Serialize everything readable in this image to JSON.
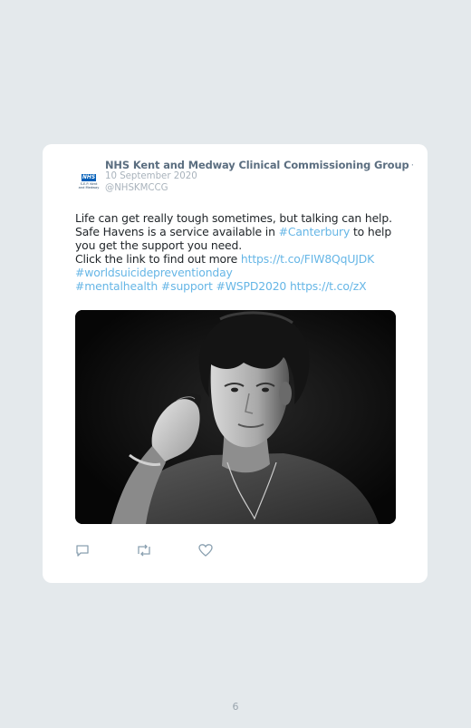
{
  "tweet": {
    "logo_mark": "NHS",
    "logo_lines": [
      "S.E.P. Kent",
      "and Medway"
    ],
    "author_name": "NHS Kent and Medway Clinical Commissioning Group",
    "name_separator": "·",
    "date": "10 September 2020",
    "handle": "@NHSKMCCG",
    "text": {
      "line1": "Life can get really tough sometimes, but talking can help.",
      "line2_before": "Safe Havens is a service available in ",
      "line2_link": "#Canterbury",
      "line2_after": " to help",
      "line3": "you get the support you need.",
      "line4_before": "Click the link to find out more ",
      "line4_link": "https://t.co/FIW8QqUJDK",
      "line5_link": "#worldsuicidepreventionday",
      "line6_link1": "#mentalhealth",
      "line6_link2": "#support",
      "line6_link3": "#WSPD2020",
      "line6_link4": "https://t.co/zX"
    },
    "image_alt": "Black and white photo of a young man talking on a mobile phone",
    "actions": {
      "reply_icon": "reply-icon",
      "retweet_icon": "retweet-icon",
      "like_icon": "heart-icon"
    },
    "colors": {
      "link": "#66b6e6",
      "name": "#5b6e80",
      "meta": "#a9b3bc",
      "background": "#e4e9ec"
    }
  },
  "page": {
    "number": "6"
  }
}
